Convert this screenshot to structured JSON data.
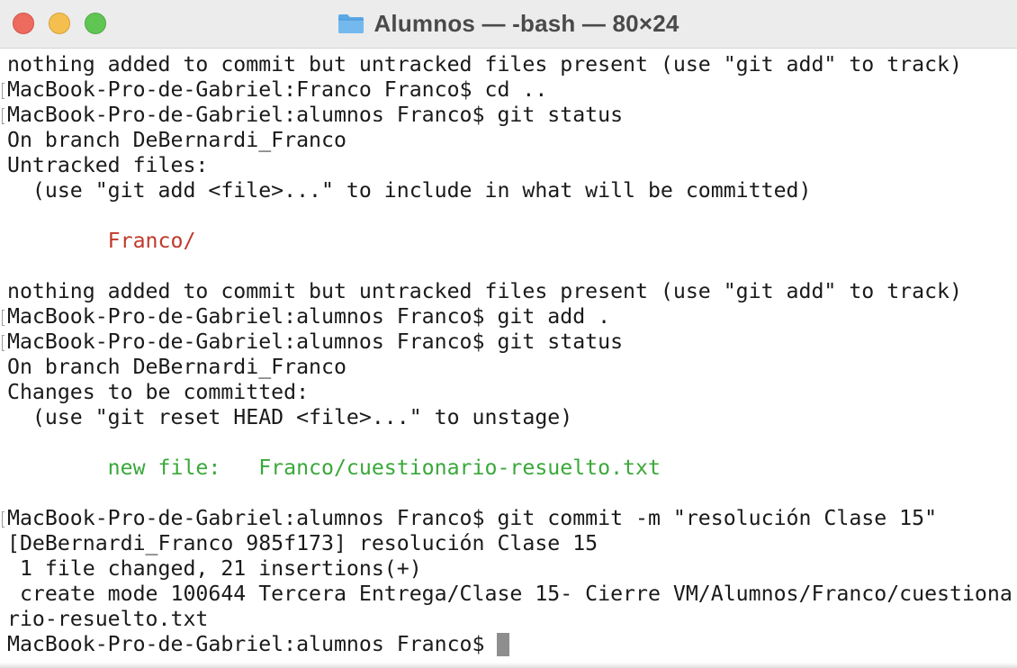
{
  "window": {
    "title": "Alumnos — -bash — 80×24",
    "icon": "folder-icon"
  },
  "colors": {
    "untracked": "#c0392b",
    "staged": "#3aa83a",
    "text": "#1a1a1a",
    "cursor": "#8e8e8e"
  },
  "terminal": {
    "lines": [
      {
        "text": "nothing added to commit but untracked files present (use \"git add\" to track)",
        "style": "normal",
        "marked": false
      },
      {
        "text": "MacBook-Pro-de-Gabriel:Franco Franco$ cd ..",
        "style": "normal",
        "marked": true
      },
      {
        "text": "MacBook-Pro-de-Gabriel:alumnos Franco$ git status",
        "style": "normal",
        "marked": true
      },
      {
        "text": "On branch DeBernardi_Franco",
        "style": "normal",
        "marked": false
      },
      {
        "text": "Untracked files:",
        "style": "normal",
        "marked": false
      },
      {
        "text": "  (use \"git add <file>...\" to include in what will be committed)",
        "style": "normal",
        "marked": false
      },
      {
        "text": "",
        "style": "normal",
        "marked": false
      },
      {
        "text": "        Franco/",
        "style": "red",
        "marked": false
      },
      {
        "text": "",
        "style": "normal",
        "marked": false
      },
      {
        "text": "nothing added to commit but untracked files present (use \"git add\" to track)",
        "style": "normal",
        "marked": false
      },
      {
        "text": "MacBook-Pro-de-Gabriel:alumnos Franco$ git add .",
        "style": "normal",
        "marked": true
      },
      {
        "text": "MacBook-Pro-de-Gabriel:alumnos Franco$ git status",
        "style": "normal",
        "marked": true
      },
      {
        "text": "On branch DeBernardi_Franco",
        "style": "normal",
        "marked": false
      },
      {
        "text": "Changes to be committed:",
        "style": "normal",
        "marked": false
      },
      {
        "text": "  (use \"git reset HEAD <file>...\" to unstage)",
        "style": "normal",
        "marked": false
      },
      {
        "text": "",
        "style": "normal",
        "marked": false
      },
      {
        "text": "        new file:   Franco/cuestionario-resuelto.txt",
        "style": "green",
        "marked": false
      },
      {
        "text": "",
        "style": "normal",
        "marked": false
      },
      {
        "text": "MacBook-Pro-de-Gabriel:alumnos Franco$ git commit -m \"resolución Clase 15\"",
        "style": "normal",
        "marked": true
      },
      {
        "text": "[DeBernardi_Franco 985f173] resolución Clase 15",
        "style": "normal",
        "marked": false
      },
      {
        "text": " 1 file changed, 21 insertions(+)",
        "style": "normal",
        "marked": false
      },
      {
        "text": " create mode 100644 Tercera Entrega/Clase 15- Cierre VM/Alumnos/Franco/cuestiona",
        "style": "normal",
        "marked": false
      },
      {
        "text": "rio-resuelto.txt",
        "style": "normal",
        "marked": false
      }
    ],
    "prompt": "MacBook-Pro-de-Gabriel:alumnos Franco$ "
  }
}
